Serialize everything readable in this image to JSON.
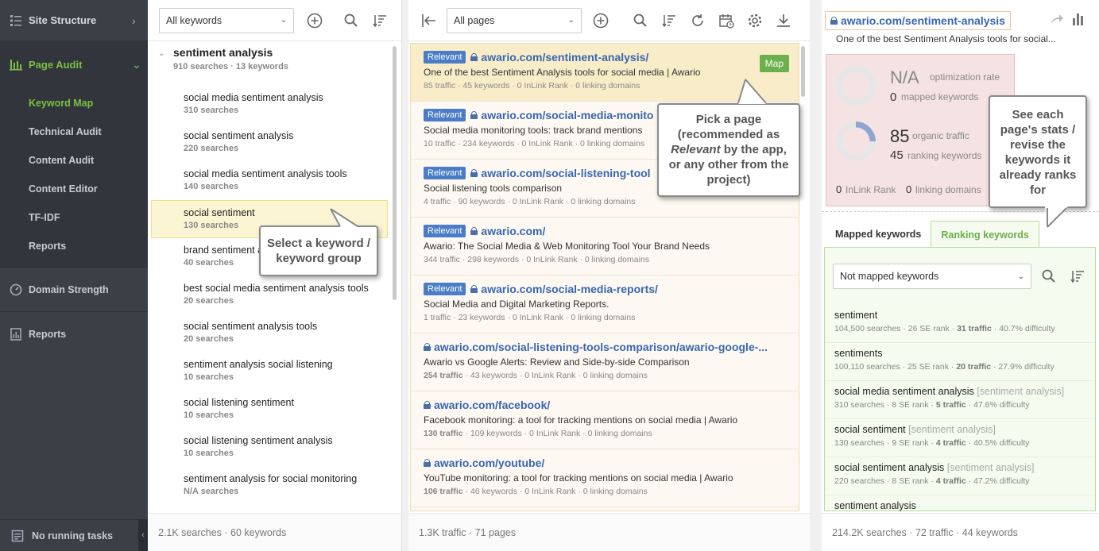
{
  "sidebar": {
    "site_structure": "Site Structure",
    "page_audit": "Page Audit",
    "sub_items": [
      "Keyword Map",
      "Technical Audit",
      "Content Audit",
      "Content Editor",
      "TF-IDF",
      "Reports"
    ],
    "domain_strength": "Domain Strength",
    "reports": "Reports",
    "bottom_status": "No running tasks"
  },
  "keywords_panel": {
    "filter": "All keywords",
    "group": {
      "title": "sentiment analysis",
      "meta": "910 searches · 13 keywords"
    },
    "items": [
      {
        "name": "social media sentiment analysis",
        "sub": "310 searches"
      },
      {
        "name": "social sentiment analysis",
        "sub": "220 searches"
      },
      {
        "name": "social media sentiment analysis tools",
        "sub": "140 searches"
      },
      {
        "name": "social sentiment",
        "sub": "130 searches"
      },
      {
        "name": "brand sentiment a",
        "sub": "40 searches"
      },
      {
        "name": "best social media sentiment analysis tools",
        "sub": "20 searches"
      },
      {
        "name": "social sentiment analysis tools",
        "sub": "20 searches"
      },
      {
        "name": "sentiment analysis social listening",
        "sub": "10 searches"
      },
      {
        "name": "social listening sentiment",
        "sub": "10 searches"
      },
      {
        "name": "social listening sentiment analysis",
        "sub": "10 searches"
      },
      {
        "name": "sentiment analysis for social monitoring",
        "sub": "N/A searches"
      }
    ],
    "footer": "2.1K searches · 60 keywords"
  },
  "pages_panel": {
    "filter": "All pages",
    "relevant_label": "Relevant",
    "map_label": "Map",
    "pages": [
      {
        "relevant": true,
        "url": "awario.com/sentiment-analysis/",
        "title": "One of the best Sentiment Analysis tools for social media | Awario",
        "traffic": "85 traffic",
        "rest": " · 45 keywords · 0 InLink Rank · 0 linking domains"
      },
      {
        "relevant": true,
        "url": "awario.com/social-media-monito",
        "title": "Social media monitoring tools: track brand mentions",
        "traffic": "10 traffic",
        "rest": " · 234 keywords · 0 InLink Rank · 0 linking domains"
      },
      {
        "relevant": true,
        "url": "awario.com/social-listening-tool",
        "title": "Social listening tools comparison",
        "traffic": "4 traffic",
        "rest": " · 90 keywords · 0 InLink Rank · 0 linking domains"
      },
      {
        "relevant": true,
        "url": "awario.com/",
        "title": "Awario: The Social Media & Web Monitoring Tool Your Brand Needs",
        "traffic": "344 traffic",
        "rest": " · 298 keywords · 0 InLink Rank · 0 linking domains"
      },
      {
        "relevant": true,
        "url": "awario.com/social-media-reports/",
        "title": "Social Media and Digital Marketing Reports.",
        "traffic": "1 traffic",
        "rest": " · 23 keywords · 0 InLink Rank · 0 linking domains"
      },
      {
        "relevant": false,
        "url": "awario.com/social-listening-tools-comparison/awario-google-...",
        "title": "Awario vs Google Alerts: Review and Side-by-side Comparison",
        "traffic": "254 traffic",
        "rest": " · 43 keywords · 0 InLink Rank · 0 linking domains"
      },
      {
        "relevant": false,
        "url": "awario.com/facebook/",
        "title": "Facebook monitoring: a tool for tracking mentions on social media | Awario",
        "traffic": "130 traffic",
        "rest": " · 109 keywords · 0 InLink Rank · 0 linking domains"
      },
      {
        "relevant": false,
        "url": "awario.com/youtube/",
        "title": "YouTube monitoring: a tool for tracking mentions on social media | Awario",
        "traffic": "106 traffic",
        "rest": " · 46 keywords · 0 InLink Rank · 0 linking domains"
      }
    ],
    "footer": "1.3K traffic · 71 pages"
  },
  "detail_panel": {
    "url": "awario.com/sentiment-analysis",
    "desc": "One of the best Sentiment Analysis tools for social...",
    "opt_value": "N/A",
    "opt_label": "optimization rate",
    "mapped_value": "0",
    "mapped_label": "mapped keywords",
    "organic_value": "85",
    "organic_label": "organic traffic",
    "ranking_value": "45",
    "ranking_label": "ranking keywords",
    "inlink_value": "0",
    "inlink_label": "InLink Rank",
    "linking_value": "0",
    "linking_label": "linking domains",
    "tab_mapped": "Mapped keywords",
    "tab_ranking": "Ranking keywords",
    "filter": "Not mapped keywords",
    "keywords": [
      {
        "name": "sentiment",
        "group": "",
        "searches": "104,500 searches · 26 SE rank · ",
        "traffic": "31 traffic",
        "diff": " · 40.7% difficulty"
      },
      {
        "name": "sentiments",
        "group": "",
        "searches": "100,110 searches · 25 SE rank · ",
        "traffic": "20 traffic",
        "diff": " · 27.9% difficulty"
      },
      {
        "name": "social media sentiment analysis",
        "group": "[sentiment analysis]",
        "searches": "310 searches · 8 SE rank · ",
        "traffic": "5 traffic",
        "diff": " · 47.6% difficulty"
      },
      {
        "name": "social sentiment",
        "group": "[sentiment analysis]",
        "searches": "130 searches · 9 SE rank · ",
        "traffic": "4 traffic",
        "diff": " · 40.5% difficulty"
      },
      {
        "name": "social sentiment analysis",
        "group": "[sentiment analysis]",
        "searches": "220 searches · 8 SE rank · ",
        "traffic": "4 traffic",
        "diff": " · 47.2% difficulty"
      },
      {
        "name": "sentiment analysis",
        "group": "",
        "searches": "",
        "traffic": "",
        "diff": ""
      }
    ],
    "footer": "214.2K searches · 72 traffic · 44 keywords",
    "optimization_rate_fill": 0,
    "organic_fill": 0.25
  },
  "callouts": {
    "keyword": "Select a keyword / keyword group",
    "page_pre": "Pick a page (recommended as ",
    "page_em": "Relevant",
    "page_post": " by the app, or any other from the project)",
    "stats": "See each page's stats / revise the keywords it already ranks for"
  },
  "colors": {
    "accent_green": "#6ab04c",
    "link_blue": "#3867b0",
    "sidebar_bg": "#3b3f46"
  }
}
